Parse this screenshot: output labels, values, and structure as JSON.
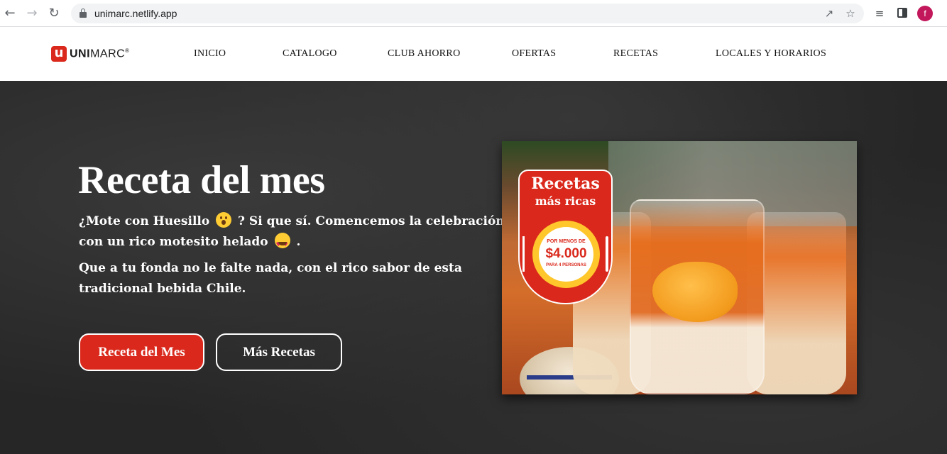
{
  "browser": {
    "url": "unimarc.netlify.app",
    "back_icon": "arrow-left-icon",
    "forward_icon": "arrow-right-icon",
    "reload_icon": "reload-icon",
    "avatar_initial": "f"
  },
  "site": {
    "logo_mark": "u",
    "logo_bold": "UNI",
    "logo_rest": "MARC",
    "logo_reg": "®",
    "brand_color": "#da291c",
    "nav": [
      {
        "label": "INICIO"
      },
      {
        "label": "CATALOGO"
      },
      {
        "label": "CLUB AHORRO"
      },
      {
        "label": "OFERTAS"
      },
      {
        "label": "RECETAS"
      },
      {
        "label": "LOCALES Y HORARIOS"
      }
    ]
  },
  "hero": {
    "title": "Receta del mes",
    "line1_a": "¿Mote con Huesillo",
    "line1_b": "? Si que sí. Comencemos la celebración",
    "line2_a": "con un rico motesito helado",
    "line2_b": ".",
    "line3": "Que a tu fonda no le falte nada, con el rico sabor de esta",
    "line4": "tradicional bebida Chile.",
    "primary_button": "Receta del Mes",
    "secondary_button": "Más Recetas"
  },
  "promo_badge": {
    "title": "Recetas",
    "subtitle": "más ricas",
    "price_prefix": "POR MENOS DE",
    "price": "$4.000",
    "price_suffix": "PARA 4 PERSONAS"
  }
}
